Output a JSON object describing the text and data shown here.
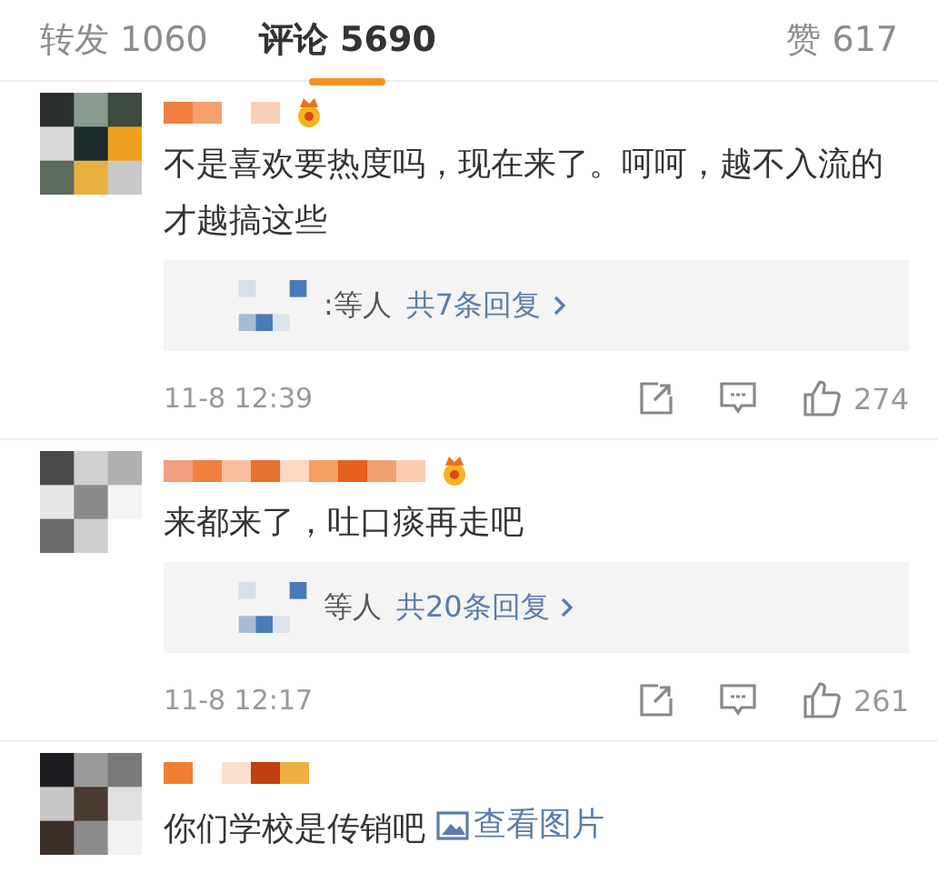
{
  "tabs": [
    {
      "label": "转发",
      "count": "1060",
      "selected": false
    },
    {
      "label": "评论",
      "count": "5690",
      "selected": true
    },
    {
      "label": "赞",
      "count": "617",
      "selected": false
    }
  ],
  "comments": [
    {
      "badge": true,
      "text": "不是喜欢要热度吗，现在来了。呵呵，越不入流的才越搞这些",
      "replies": {
        "suffix": ":等人",
        "link": "共7条回复"
      },
      "time": "11-8 12:39",
      "likes": "274"
    },
    {
      "badge": true,
      "text": "来都来了，吐口痰再走吧",
      "replies": {
        "suffix": "等人",
        "link": "共20条回复"
      },
      "time": "11-8 12:17",
      "likes": "261"
    },
    {
      "badge": false,
      "text": "你们学校是传销吧",
      "image_link": "查看图片"
    }
  ]
}
